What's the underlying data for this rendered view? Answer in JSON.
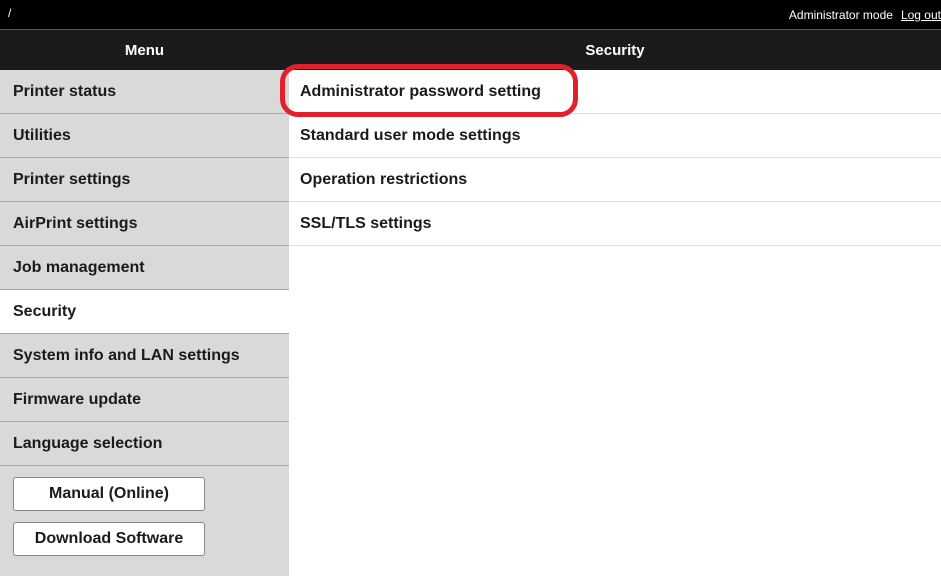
{
  "topbar": {
    "path": "/",
    "mode": "Administrator mode",
    "logout": "Log out"
  },
  "header": {
    "menu_title": "Menu",
    "section_title": "Security"
  },
  "sidebar": {
    "items": [
      {
        "label": "Printer status"
      },
      {
        "label": "Utilities"
      },
      {
        "label": "Printer settings"
      },
      {
        "label": "AirPrint settings"
      },
      {
        "label": "Job management"
      },
      {
        "label": "Security"
      },
      {
        "label": "System info and LAN settings"
      },
      {
        "label": "Firmware update"
      },
      {
        "label": "Language selection"
      }
    ],
    "active_index": 5,
    "buttons": {
      "manual": "Manual (Online)",
      "download": "Download Software"
    }
  },
  "content": {
    "items": [
      {
        "label": "Administrator password setting"
      },
      {
        "label": "Standard user mode settings"
      },
      {
        "label": "Operation restrictions"
      },
      {
        "label": "SSL/TLS settings"
      }
    ]
  },
  "colors": {
    "highlight": "#e0202b",
    "sidebar_bg": "#d9d9d9",
    "header_bg": "#1b1b1b"
  }
}
